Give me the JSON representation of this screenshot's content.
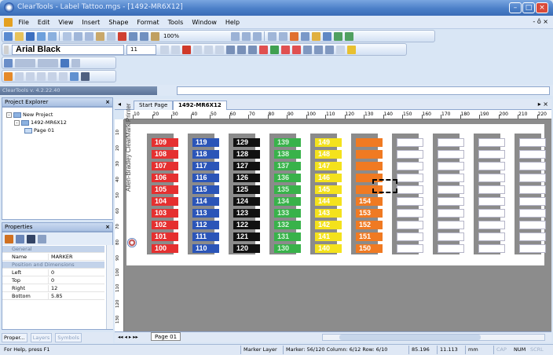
{
  "window": {
    "title": "ClearTools - Label Tattoo.mgs - [1492-MR6X12]",
    "minimize_glyph": "–",
    "maximize_glyph": "□",
    "close_glyph": "×",
    "mdi_controls": "- ô ×"
  },
  "menu": [
    "File",
    "Edit",
    "View",
    "Insert",
    "Shape",
    "Format",
    "Tools",
    "Window",
    "Help"
  ],
  "toolbar": {
    "zoom": "100%",
    "font_name": "Arial Black",
    "font_size": "11"
  },
  "version_text": "ClearTools v. 4.2.22.40",
  "project_explorer": {
    "title": "Project Explorer",
    "close": "×",
    "tree": [
      "New Project",
      "1492-MR6X12",
      "Page 01"
    ]
  },
  "properties": {
    "title": "Properties",
    "close": "×",
    "categories": [
      "General",
      "Position and Dimensions"
    ],
    "rows": [
      {
        "k": "Name",
        "v": "MARKER"
      },
      {
        "k": "Left",
        "v": "0"
      },
      {
        "k": "Top",
        "v": "0"
      },
      {
        "k": "Right",
        "v": "12"
      },
      {
        "k": "Bottom",
        "v": "5.85"
      }
    ],
    "tabs": [
      "Proper...",
      "Layers",
      "Symbols"
    ]
  },
  "doc_tabs": [
    "Start Page",
    "1492-MR6X12"
  ],
  "doc_controls": "▸ ×",
  "ruler_h": [
    "10",
    "20",
    "30",
    "40",
    "50",
    "60",
    "70",
    "80",
    "90",
    "100",
    "110",
    "120",
    "130",
    "140",
    "150",
    "160",
    "170",
    "180",
    "190",
    "200",
    "210",
    "220"
  ],
  "ruler_v": [
    "10",
    "20",
    "30",
    "40",
    "50",
    "60",
    "70",
    "80",
    "90",
    "100",
    "110",
    "120",
    "130"
  ],
  "vertical_label": "Allen-Bradley ClearMark Printer",
  "columns": [
    {
      "color": "#e53030",
      "text_color": "#ffffff",
      "cells": [
        "109",
        "108",
        "107",
        "106",
        "105",
        "104",
        "103",
        "102",
        "101",
        "100"
      ]
    },
    {
      "color": "#2b55b8",
      "text_color": "#ffffff",
      "cells": [
        "119",
        "118",
        "117",
        "116",
        "115",
        "114",
        "113",
        "112",
        "111",
        "110"
      ]
    },
    {
      "color": "#111111",
      "text_color": "#ffffff",
      "cells": [
        "129",
        "128",
        "127",
        "126",
        "125",
        "124",
        "123",
        "122",
        "121",
        "120"
      ]
    },
    {
      "color": "#38b24a",
      "text_color": "#d8f4dc",
      "cells": [
        "139",
        "138",
        "137",
        "136",
        "135",
        "134",
        "133",
        "132",
        "131",
        "130"
      ]
    },
    {
      "color": "#f4e21c",
      "text_color": "#ffffff",
      "cells": [
        "149",
        "148",
        "147",
        "146",
        "145",
        "144",
        "143",
        "142",
        "141",
        "140"
      ]
    },
    {
      "color": "#f07a22",
      "text_color": "#ffffff",
      "cells": [
        "",
        "",
        "",
        "",
        "",
        "154",
        "153",
        "152",
        "151",
        "150"
      ]
    },
    {
      "color": "#ffffff",
      "text_color": "#000000",
      "cells": [
        "",
        "",
        "",
        "",
        "",
        "",
        "",
        "",
        "",
        ""
      ]
    },
    {
      "color": "#ffffff",
      "text_color": "#000000",
      "cells": [
        "",
        "",
        "",
        "",
        "",
        "",
        "",
        "",
        "",
        ""
      ]
    },
    {
      "color": "#ffffff",
      "text_color": "#000000",
      "cells": [
        "",
        "",
        "",
        "",
        "",
        "",
        "",
        "",
        "",
        ""
      ]
    },
    {
      "color": "#ffffff",
      "text_color": "#000000",
      "cells": [
        "",
        "",
        "",
        "",
        "",
        "",
        "",
        "",
        "",
        ""
      ]
    }
  ],
  "page_tab": "Page 01",
  "nav": "◂◂ ◂ ▸ ▸▸",
  "status": {
    "help": "For Help, press F1",
    "layer": "Marker Layer",
    "marker": "Marker: 56/120 Column: 6/12 Row: 6/10",
    "x": "85.196",
    "y": "11.113",
    "unit": "mm",
    "cap": "CAP",
    "num": "NUM",
    "scrl": "SCRL"
  }
}
